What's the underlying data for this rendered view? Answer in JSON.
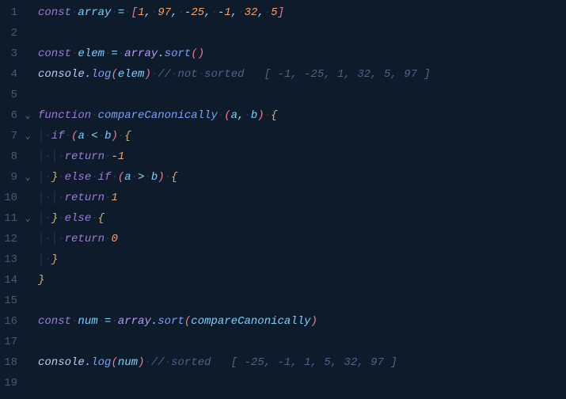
{
  "lines": [
    {
      "n": "1",
      "fold": "",
      "tokens": [
        [
          "kw",
          "const"
        ],
        [
          "ws",
          "·"
        ],
        [
          "var",
          "array"
        ],
        [
          "ws",
          "·"
        ],
        [
          "op",
          "="
        ],
        [
          "ws",
          "·"
        ],
        [
          "paren",
          "["
        ],
        [
          "num",
          "1"
        ],
        [
          "punct",
          ","
        ],
        [
          "ws",
          "·"
        ],
        [
          "num",
          "97"
        ],
        [
          "punct",
          ","
        ],
        [
          "ws",
          "·"
        ],
        [
          "op",
          "-"
        ],
        [
          "num",
          "25"
        ],
        [
          "punct",
          ","
        ],
        [
          "ws",
          "·"
        ],
        [
          "op",
          "-"
        ],
        [
          "num",
          "1"
        ],
        [
          "punct",
          ","
        ],
        [
          "ws",
          "·"
        ],
        [
          "num",
          "32"
        ],
        [
          "punct",
          ","
        ],
        [
          "ws",
          "·"
        ],
        [
          "num",
          "5"
        ],
        [
          "paren",
          "]"
        ]
      ]
    },
    {
      "n": "2",
      "fold": "",
      "tokens": []
    },
    {
      "n": "3",
      "fold": "",
      "tokens": [
        [
          "kw",
          "const"
        ],
        [
          "ws",
          "·"
        ],
        [
          "var",
          "elem"
        ],
        [
          "ws",
          "·"
        ],
        [
          "op",
          "="
        ],
        [
          "ws",
          "·"
        ],
        [
          "ital",
          "array"
        ],
        [
          "punct",
          "."
        ],
        [
          "fn",
          "sort"
        ],
        [
          "paren",
          "("
        ],
        [
          "paren",
          ")"
        ]
      ]
    },
    {
      "n": "4",
      "fold": "",
      "tokens": [
        [
          "obj",
          "console"
        ],
        [
          "punct",
          "."
        ],
        [
          "fn",
          "log"
        ],
        [
          "paren",
          "("
        ],
        [
          "var",
          "elem"
        ],
        [
          "paren",
          ")"
        ],
        [
          "ws",
          "·"
        ],
        [
          "comment",
          "//"
        ],
        [
          "ws",
          "·"
        ],
        [
          "comment",
          "not"
        ],
        [
          "ws",
          "·"
        ],
        [
          "comment",
          "sorted"
        ],
        [
          "comment",
          "   [ -1, -25, 1, 32, 5, 97 ]"
        ]
      ]
    },
    {
      "n": "5",
      "fold": "",
      "tokens": []
    },
    {
      "n": "6",
      "fold": "⌄",
      "tokens": [
        [
          "kw",
          "function"
        ],
        [
          "ws",
          "·"
        ],
        [
          "fn",
          "compareCanonically"
        ],
        [
          "ws",
          "·"
        ],
        [
          "paren",
          "("
        ],
        [
          "var",
          "a"
        ],
        [
          "punct",
          ","
        ],
        [
          "ws",
          "·"
        ],
        [
          "var",
          "b"
        ],
        [
          "paren",
          ")"
        ],
        [
          "ws",
          "·"
        ],
        [
          "brace",
          "{"
        ]
      ]
    },
    {
      "n": "7",
      "fold": "⌄",
      "tokens": [
        [
          "guide",
          "│"
        ],
        [
          "ws",
          "·"
        ],
        [
          "kw",
          "if"
        ],
        [
          "ws",
          "·"
        ],
        [
          "paren",
          "("
        ],
        [
          "var",
          "a"
        ],
        [
          "ws",
          "·"
        ],
        [
          "op",
          "<"
        ],
        [
          "ws",
          "·"
        ],
        [
          "var",
          "b"
        ],
        [
          "paren",
          ")"
        ],
        [
          "ws",
          "·"
        ],
        [
          "brace",
          "{"
        ]
      ]
    },
    {
      "n": "8",
      "fold": "",
      "tokens": [
        [
          "guide",
          "│"
        ],
        [
          "ws",
          "·"
        ],
        [
          "guide",
          "│"
        ],
        [
          "ws",
          "·"
        ],
        [
          "kw",
          "return"
        ],
        [
          "ws",
          "·"
        ],
        [
          "op",
          "-"
        ],
        [
          "num",
          "1"
        ]
      ]
    },
    {
      "n": "9",
      "fold": "⌄",
      "tokens": [
        [
          "guide",
          "│"
        ],
        [
          "ws",
          "·"
        ],
        [
          "brace",
          "}"
        ],
        [
          "ws",
          "·"
        ],
        [
          "kw",
          "else"
        ],
        [
          "ws",
          "·"
        ],
        [
          "kw",
          "if"
        ],
        [
          "ws",
          "·"
        ],
        [
          "paren",
          "("
        ],
        [
          "var",
          "a"
        ],
        [
          "ws",
          "·"
        ],
        [
          "op",
          ">"
        ],
        [
          "ws",
          "·"
        ],
        [
          "var",
          "b"
        ],
        [
          "paren",
          ")"
        ],
        [
          "ws",
          "·"
        ],
        [
          "brace",
          "{"
        ]
      ]
    },
    {
      "n": "10",
      "fold": "",
      "tokens": [
        [
          "guide",
          "│"
        ],
        [
          "ws",
          "·"
        ],
        [
          "guide",
          "│"
        ],
        [
          "ws",
          "·"
        ],
        [
          "kw",
          "return"
        ],
        [
          "ws",
          "·"
        ],
        [
          "num",
          "1"
        ]
      ]
    },
    {
      "n": "11",
      "fold": "⌄",
      "tokens": [
        [
          "guide",
          "│"
        ],
        [
          "ws",
          "·"
        ],
        [
          "brace",
          "}"
        ],
        [
          "ws",
          "·"
        ],
        [
          "kw",
          "else"
        ],
        [
          "ws",
          "·"
        ],
        [
          "brace",
          "{"
        ]
      ]
    },
    {
      "n": "12",
      "fold": "",
      "tokens": [
        [
          "guide",
          "│"
        ],
        [
          "ws",
          "·"
        ],
        [
          "guide",
          "│"
        ],
        [
          "ws",
          "·"
        ],
        [
          "kw",
          "return"
        ],
        [
          "ws",
          "·"
        ],
        [
          "num",
          "0"
        ]
      ]
    },
    {
      "n": "13",
      "fold": "",
      "tokens": [
        [
          "guide",
          "│"
        ],
        [
          "ws",
          "·"
        ],
        [
          "brace",
          "}"
        ]
      ]
    },
    {
      "n": "14",
      "fold": "",
      "tokens": [
        [
          "brace",
          "}"
        ]
      ]
    },
    {
      "n": "15",
      "fold": "",
      "tokens": []
    },
    {
      "n": "16",
      "fold": "",
      "tokens": [
        [
          "kw",
          "const"
        ],
        [
          "ws",
          "·"
        ],
        [
          "var",
          "num"
        ],
        [
          "ws",
          "·"
        ],
        [
          "op",
          "="
        ],
        [
          "ws",
          "·"
        ],
        [
          "ital",
          "array"
        ],
        [
          "punct",
          "."
        ],
        [
          "fn",
          "sort"
        ],
        [
          "paren",
          "("
        ],
        [
          "var",
          "compareCanonically"
        ],
        [
          "paren",
          ")"
        ]
      ]
    },
    {
      "n": "17",
      "fold": "",
      "tokens": []
    },
    {
      "n": "18",
      "fold": "",
      "tokens": [
        [
          "obj",
          "console"
        ],
        [
          "punct",
          "."
        ],
        [
          "fn",
          "log"
        ],
        [
          "paren",
          "("
        ],
        [
          "var",
          "num"
        ],
        [
          "paren",
          ")"
        ],
        [
          "ws",
          "·"
        ],
        [
          "comment",
          "//"
        ],
        [
          "ws",
          "·"
        ],
        [
          "comment",
          "sorted"
        ],
        [
          "comment",
          "   [ -25, -1, 1, 5, 32, 97 ]"
        ]
      ]
    },
    {
      "n": "19",
      "fold": "",
      "tokens": []
    }
  ]
}
